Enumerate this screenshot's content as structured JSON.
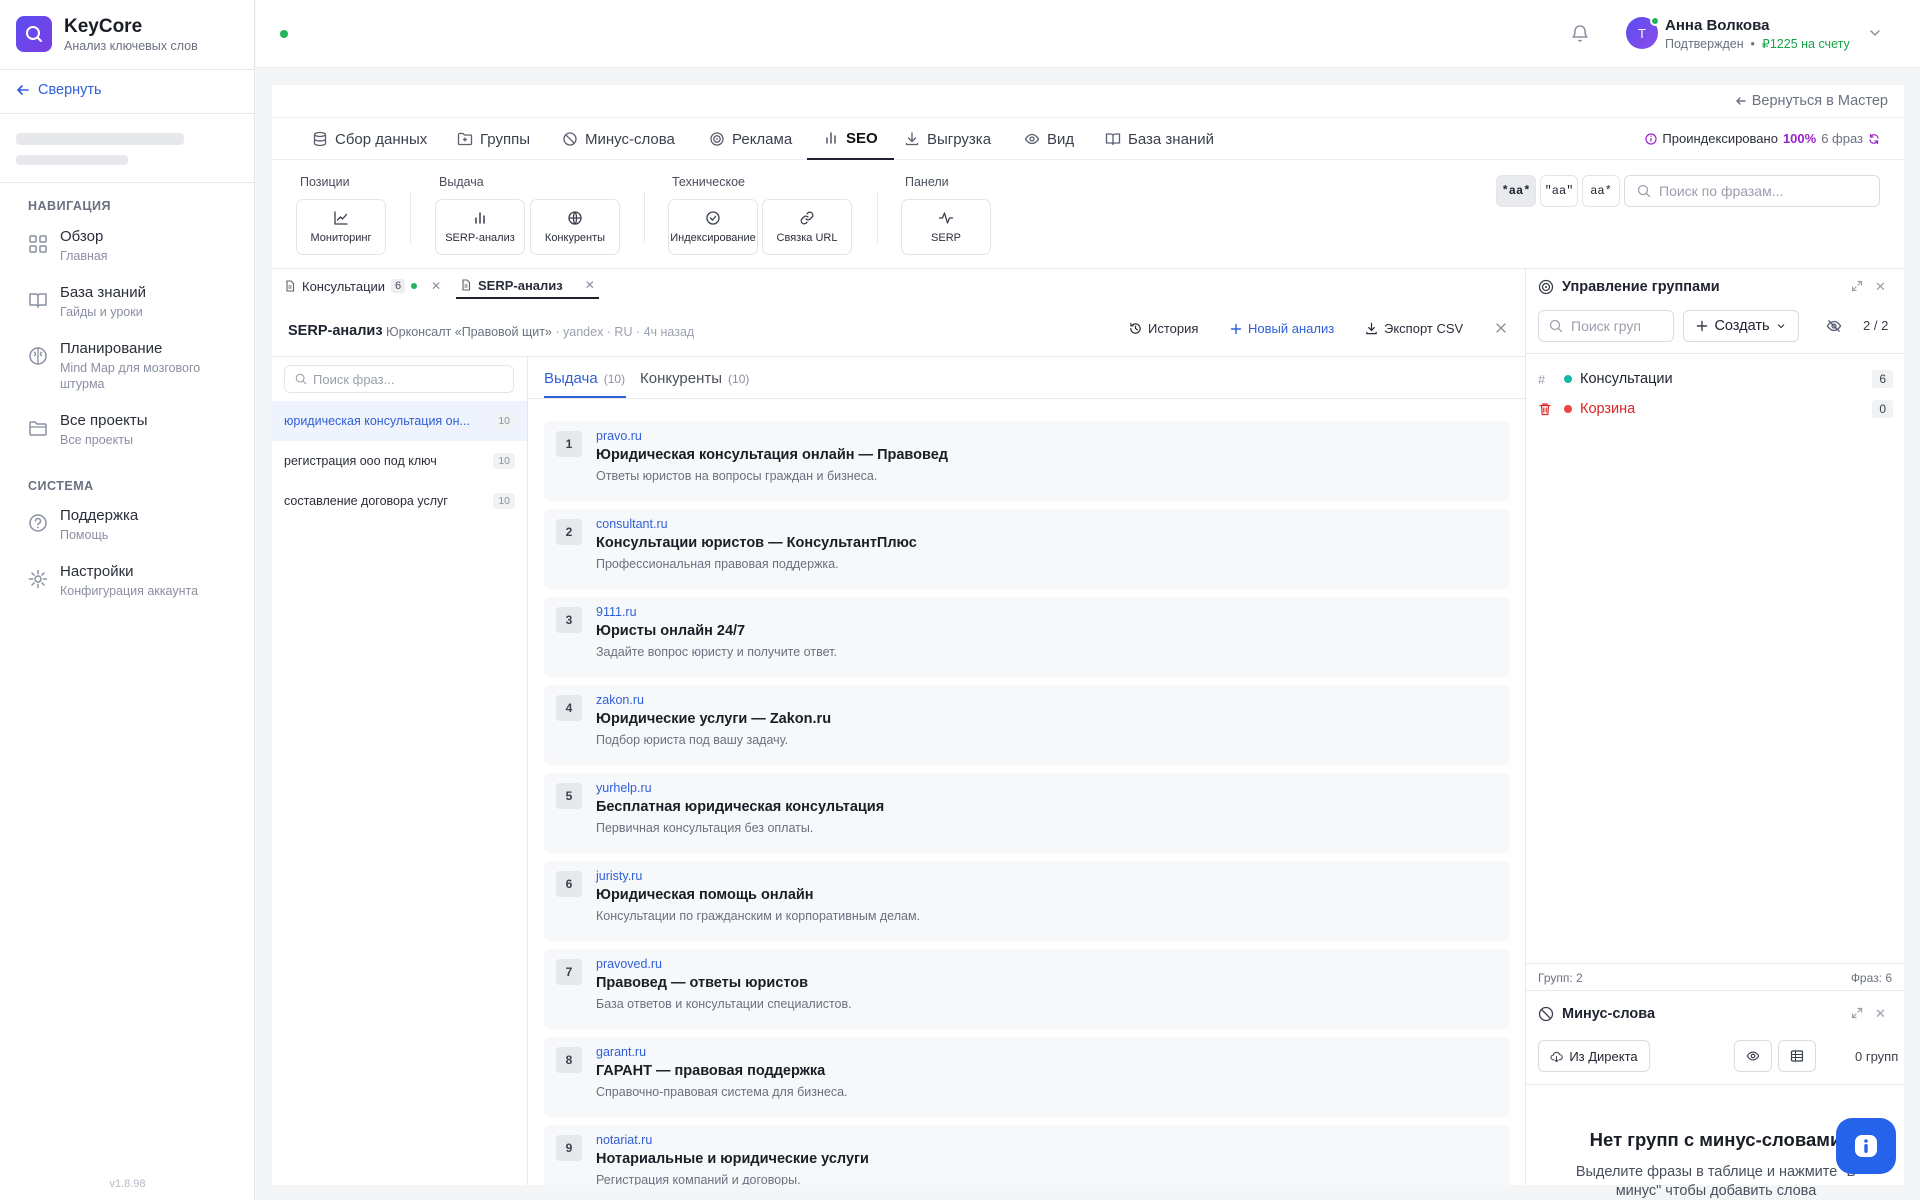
{
  "app": {
    "name": "KeyCore",
    "subtitle": "Анализ ключевых слов",
    "version": "v1.8.98"
  },
  "sidebar": {
    "collapse_label": "Свернуть",
    "sections": [
      {
        "title": "НАВИГАЦИЯ",
        "items": [
          {
            "title": "Обзор",
            "sub": "Главная",
            "icon": "grid-icon"
          },
          {
            "title": "База знаний",
            "sub": "Гайды и уроки",
            "icon": "book-icon"
          },
          {
            "title": "Планирование",
            "sub": "Mind Map для мозгового штурма",
            "icon": "brain-icon"
          },
          {
            "title": "Все проекты",
            "sub": "Все проекты",
            "icon": "folder-icon"
          }
        ]
      },
      {
        "title": "СИСТЕМА",
        "items": [
          {
            "title": "Поддержка",
            "sub": "Помощь",
            "icon": "help-circle-icon"
          },
          {
            "title": "Настройки",
            "sub": "Конфигурация аккаунта",
            "icon": "gear-icon"
          }
        ]
      }
    ]
  },
  "user": {
    "initial": "Т",
    "name": "Анна Волкова",
    "status": "Подтвержден",
    "balance": "₽1225 на счету"
  },
  "main": {
    "back_label": "Вернуться в Мастер",
    "tabs": [
      "Сбор данных",
      "Группы",
      "Минус-слова",
      "Реклама",
      "SEO",
      "Выгрузка",
      "Вид",
      "База знаний"
    ],
    "active_tab": "SEO",
    "indexed": {
      "label": "Проиндексировано",
      "pct": "100%",
      "count": "6 фраз"
    }
  },
  "toolbar": {
    "groups": [
      "Позиции",
      "Выдача",
      "Техническое",
      "Панели"
    ],
    "buttons": [
      "Мониторинг",
      "SERP-анализ",
      "Конкуренты",
      "Индексирование",
      "Связка URL",
      "SERP"
    ],
    "case_buttons": [
      "*аа*",
      "\"аа\"",
      "аа*"
    ],
    "active_case": "*аа*",
    "search_placeholder": "Поиск по фразам..."
  },
  "doc_tabs": [
    {
      "label": "Консультации",
      "badge": "6"
    },
    {
      "label": "SERP-анализ",
      "badge": ""
    }
  ],
  "serp": {
    "title": "SERP-анализ",
    "project": "Юрконсалт «Правовой щит»",
    "meta": "· yandex · RU · 4ч назад",
    "actions": {
      "history": "История",
      "new": "Новый анализ",
      "export": "Экспорт CSV"
    },
    "phrase_search_placeholder": "Поиск фраз...",
    "phrases": [
      {
        "text": "юридическая консультация он...",
        "count": "10"
      },
      {
        "text": "регистрация ооо под ключ",
        "count": "10"
      },
      {
        "text": "составление договора услуг",
        "count": "10"
      }
    ],
    "result_tabs": [
      {
        "label": "Выдача",
        "count": "(10)"
      },
      {
        "label": "Конкуренты",
        "count": "(10)"
      }
    ],
    "results": [
      {
        "pos": "1",
        "domain": "pravo.ru",
        "title": "Юридическая консультация онлайн — Правовед",
        "desc": "Ответы юристов на вопросы граждан и бизнеса."
      },
      {
        "pos": "2",
        "domain": "consultant.ru",
        "title": "Консультации юристов — КонсультантПлюс",
        "desc": "Профессиональная правовая поддержка."
      },
      {
        "pos": "3",
        "domain": "9111.ru",
        "title": "Юристы онлайн 24/7",
        "desc": "Задайте вопрос юристу и получите ответ."
      },
      {
        "pos": "4",
        "domain": "zakon.ru",
        "title": "Юридические услуги — Zakon.ru",
        "desc": "Подбор юриста под вашу задачу."
      },
      {
        "pos": "5",
        "domain": "yurhelp.ru",
        "title": "Бесплатная юридическая консультация",
        "desc": "Первичная консультация без оплаты."
      },
      {
        "pos": "6",
        "domain": "juristy.ru",
        "title": "Юридическая помощь онлайн",
        "desc": "Консультации по гражданским и корпоративным делам."
      },
      {
        "pos": "7",
        "domain": "pravoved.ru",
        "title": "Правовед — ответы юристов",
        "desc": "База ответов и консультации специалистов."
      },
      {
        "pos": "8",
        "domain": "garant.ru",
        "title": "ГАРАНТ — правовая поддержка",
        "desc": "Справочно-правовая система для бизнеса."
      },
      {
        "pos": "9",
        "domain": "notariat.ru",
        "title": "Нотариальные и юридические услуги",
        "desc": "Регистрация компаний и договоры."
      }
    ]
  },
  "groups_panel": {
    "title": "Управление группами",
    "search_placeholder": "Поиск груп",
    "create_label": "Создать",
    "count": "2 / 2",
    "groups": [
      {
        "name": "Консультации",
        "count": "6",
        "color": "#14b8a6"
      },
      {
        "name": "Корзина",
        "count": "0",
        "color": "#ef4444"
      }
    ],
    "footer_left": "Групп: 2",
    "footer_right": "Фраз: 6"
  },
  "minus_panel": {
    "title": "Минус-слова",
    "from_direct": "Из Директа",
    "groups_count": "0 групп",
    "empty_title": "Нет групп с минус-словами",
    "empty_desc": "Выделите фразы в таблице и нажмите \"В минус\" чтобы добавить слова"
  },
  "colors": {
    "accent": "#2f5fd8",
    "brand": "#5b4cf0",
    "online": "#22b35e",
    "indexed_pct": "#a020d0"
  }
}
